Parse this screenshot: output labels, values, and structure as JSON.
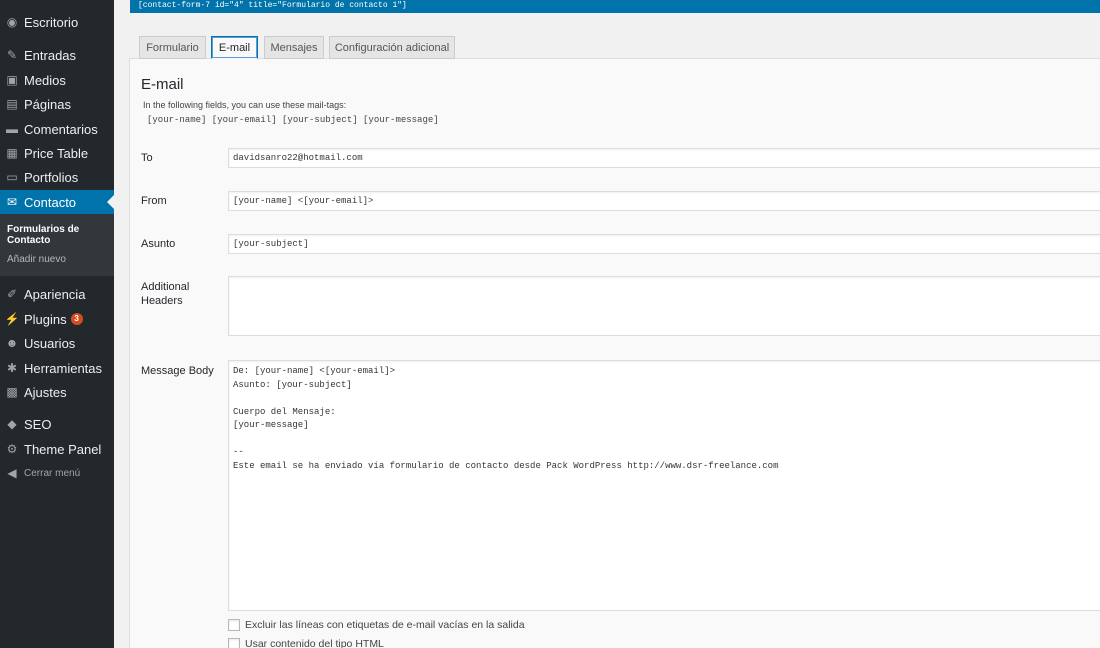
{
  "sidebar": {
    "items": [
      {
        "icon": "dashboard-icon",
        "glyph": "◉",
        "label": "Escritorio"
      },
      {
        "icon": "pin-icon",
        "glyph": "✎",
        "label": "Entradas"
      },
      {
        "icon": "media-icon",
        "glyph": "▣",
        "label": "Medios"
      },
      {
        "icon": "pages-icon",
        "glyph": "▤",
        "label": "Páginas"
      },
      {
        "icon": "comments-icon",
        "glyph": "▬",
        "label": "Comentarios"
      },
      {
        "icon": "table-icon",
        "glyph": "▦",
        "label": "Price Table"
      },
      {
        "icon": "portfolio-icon",
        "glyph": "▭",
        "label": "Portfolios"
      },
      {
        "icon": "mail-icon",
        "glyph": "✉",
        "label": "Contacto"
      },
      {
        "icon": "appearance-icon",
        "glyph": "✐",
        "label": "Apariencia"
      },
      {
        "icon": "plugins-icon",
        "glyph": "⚡",
        "label": "Plugins",
        "badge": "3"
      },
      {
        "icon": "users-icon",
        "glyph": "☻",
        "label": "Usuarios"
      },
      {
        "icon": "tools-icon",
        "glyph": "✱",
        "label": "Herramientas"
      },
      {
        "icon": "settings-icon",
        "glyph": "▩",
        "label": "Ajustes"
      },
      {
        "icon": "seo-icon",
        "glyph": "◆",
        "label": "SEO"
      },
      {
        "icon": "gear-icon",
        "glyph": "⚙",
        "label": "Theme Panel"
      },
      {
        "icon": "collapse-icon",
        "glyph": "◀",
        "label": "Cerrar menú"
      }
    ],
    "submenu": {
      "current": "Formularios de Contacto",
      "add_new": "Añadir nuevo"
    }
  },
  "shortcode": "[contact-form-7 id=\"4\" title=\"Formulario de contacto 1\"]",
  "tabs": [
    "Formulario",
    "E-mail",
    "Mensajes",
    "Configuración adicional"
  ],
  "panel": {
    "title": "E-mail",
    "hint": "In the following fields, you can use these mail-tags:",
    "tags": "[your-name] [your-email] [your-subject] [your-message]",
    "fields": {
      "to_label": "To",
      "to_value": "davidsanro22@hotmail.com",
      "from_label": "From",
      "from_value": "[your-name] <[your-email]>",
      "subject_label": "Asunto",
      "subject_value": "[your-subject]",
      "headers_label": "Additional Headers",
      "headers_value": "",
      "body_label": "Message Body",
      "body_value": "De: [your-name] <[your-email]>\nAsunto: [your-subject]\n\nCuerpo del Mensaje:\n[your-message]\n\n--\nEste email se ha enviado vía formulario de contacto desde Pack WordPress http://www.dsr-freelance.com"
    },
    "checkboxes": [
      "Excluir las líneas con etiquetas de e-mail vacías en la salida",
      "Usar contenido del tipo HTML"
    ]
  }
}
